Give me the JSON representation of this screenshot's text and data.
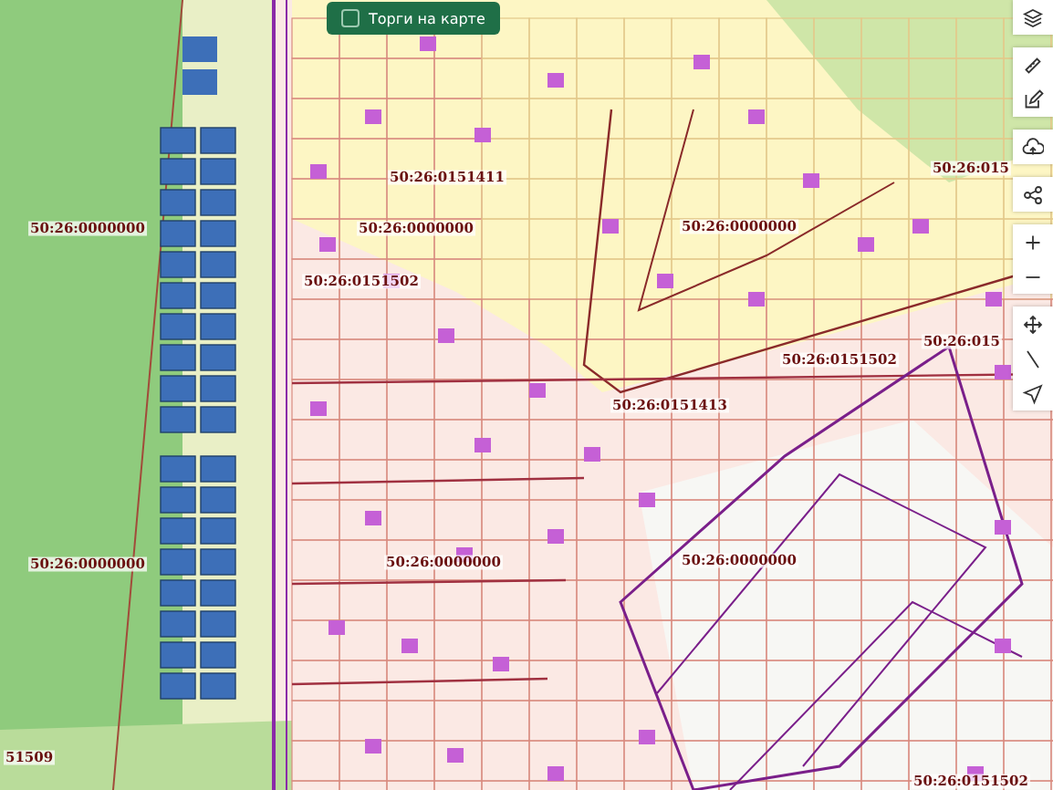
{
  "auction_toggle": {
    "label": "Торги на карте",
    "checked": false
  },
  "map_labels": [
    "50:26:0151411",
    "50:26:0000000",
    "50:26:0000000",
    "50:26:0151502",
    "50:26:0000000",
    "50:26:015",
    "50:26:015",
    "50:26:0151502",
    "50:26:0151413",
    "50:26:0000000",
    "50:26:0000000",
    "50:26:0000000",
    "51509",
    "50:26:0151502"
  ],
  "toolbar": [
    [
      {
        "kind": "layers"
      }
    ],
    [
      {
        "kind": "ruler"
      },
      {
        "kind": "edit"
      }
    ],
    [
      {
        "kind": "upload"
      }
    ],
    [
      {
        "kind": "share"
      }
    ],
    [
      {
        "kind": "zoom-in"
      },
      {
        "kind": "zoom-out"
      }
    ],
    [
      {
        "kind": "move"
      },
      {
        "kind": "line"
      },
      {
        "kind": "locate"
      }
    ]
  ]
}
